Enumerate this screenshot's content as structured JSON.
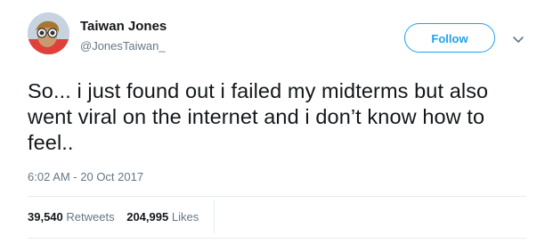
{
  "user": {
    "name": "Taiwan Jones",
    "handle": "@JonesTaiwan_"
  },
  "actions": {
    "follow_label": "Follow",
    "more_icon": "chevron-down-icon"
  },
  "tweet": {
    "text": "So... i just found out i failed my midterms but also went viral on the internet and i don’t know how to feel..",
    "timestamp": "6:02 AM - 20 Oct 2017"
  },
  "stats": {
    "retweets_count": "39,540",
    "retweets_label": "Retweets",
    "likes_count": "204,995",
    "likes_label": "Likes"
  },
  "colors": {
    "accent": "#1da1f2",
    "text": "#14171a",
    "muted": "#657786",
    "divider": "#e6ecf0"
  }
}
